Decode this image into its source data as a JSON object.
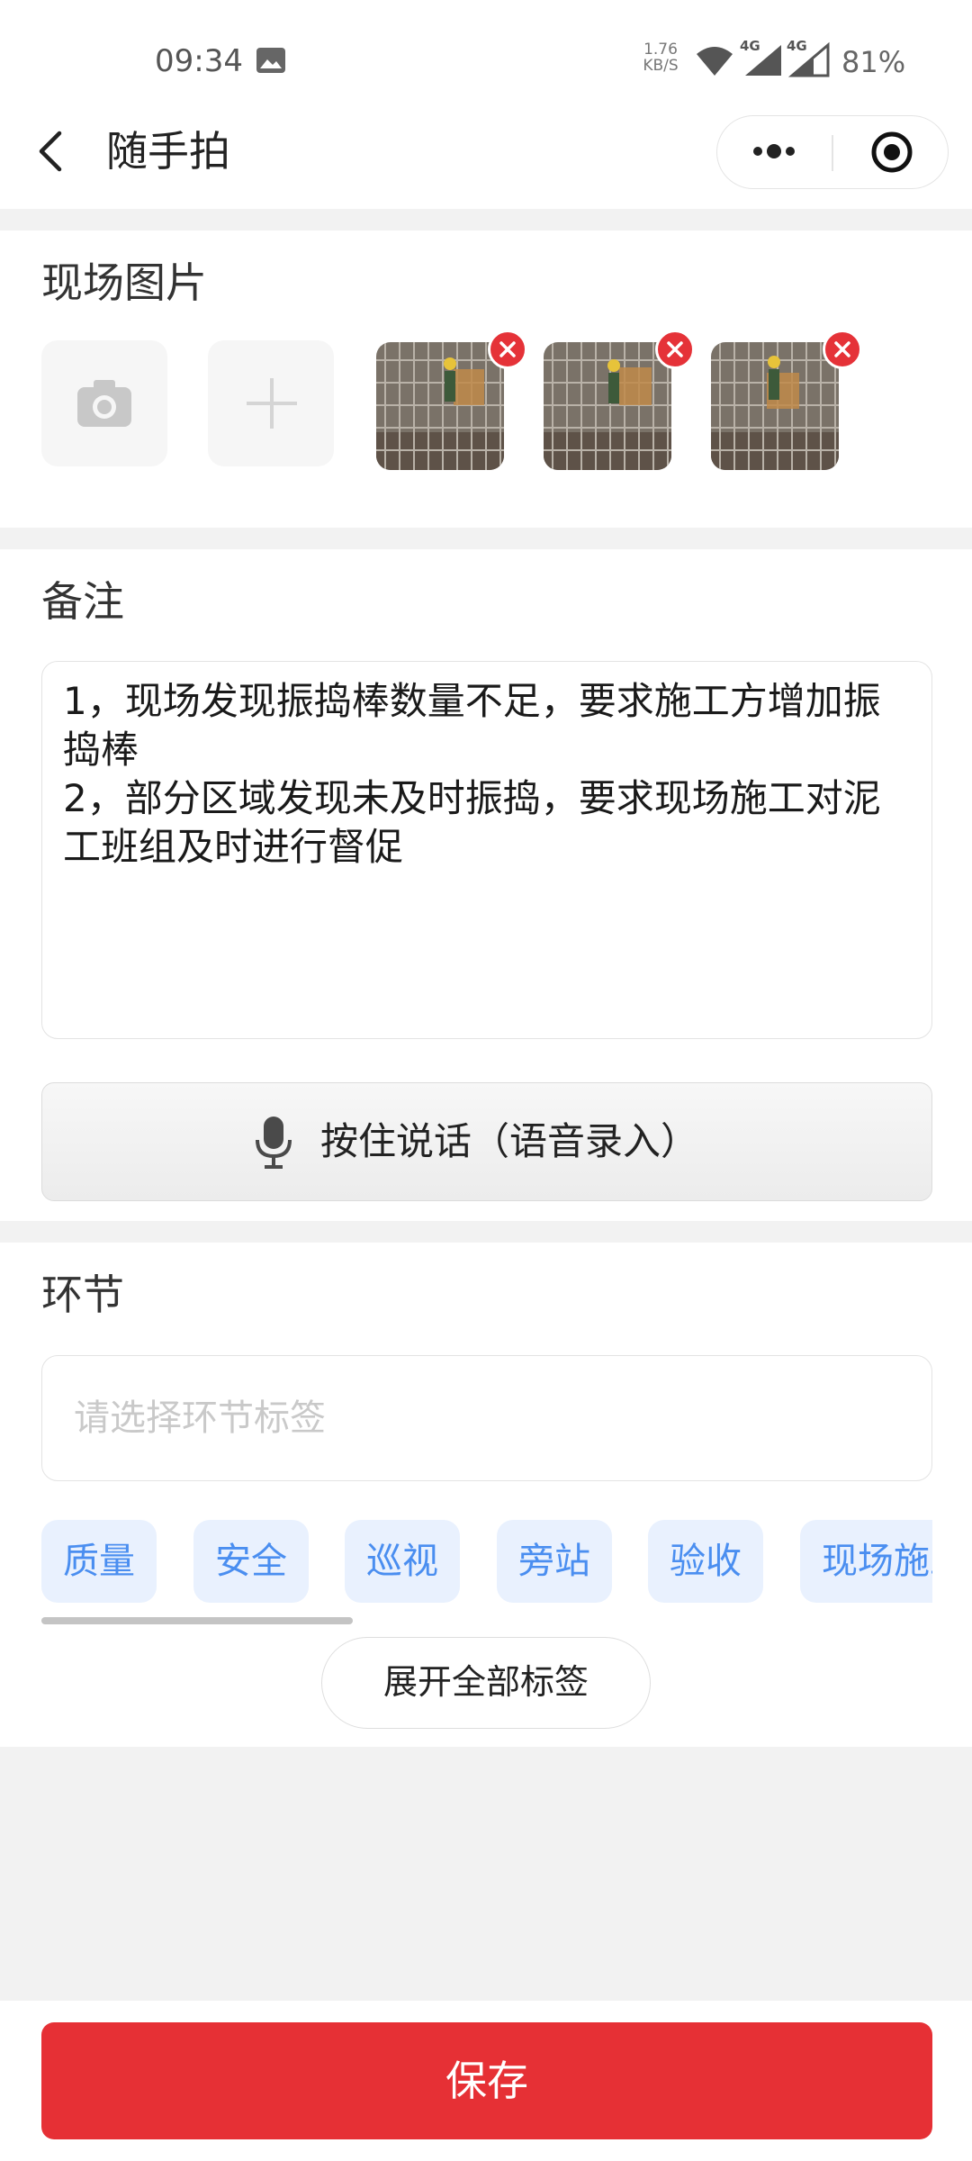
{
  "status_bar": {
    "time": "09:34",
    "net_rate_value": "1.76",
    "net_rate_unit": "KB/S",
    "signal_1_label": "4G",
    "signal_2_label": "4G",
    "battery": "81%"
  },
  "nav": {
    "title": "随手拍"
  },
  "photos": {
    "title": "现场图片",
    "thumbnails": [
      "site-photo-1",
      "site-photo-2",
      "site-photo-3"
    ]
  },
  "notes": {
    "title": "备注",
    "text": "1，现场发现振捣棒数量不足，要求施工方增加振捣棒\n2，部分区域发现未及时振捣，要求现场施工对泥工班组及时进行督促",
    "voice_button_label": "按住说话（语音录入）"
  },
  "stage": {
    "title": "环节",
    "placeholder": "请选择环节标签",
    "tags": [
      "质量",
      "安全",
      "巡视",
      "旁站",
      "验收",
      "现场施工"
    ],
    "expand_label": "展开全部标签"
  },
  "footer": {
    "save_label": "保存"
  },
  "colors": {
    "primary_red": "#e63035",
    "tag_bg": "#e9f1fe",
    "tag_text": "#4a8ef0"
  }
}
